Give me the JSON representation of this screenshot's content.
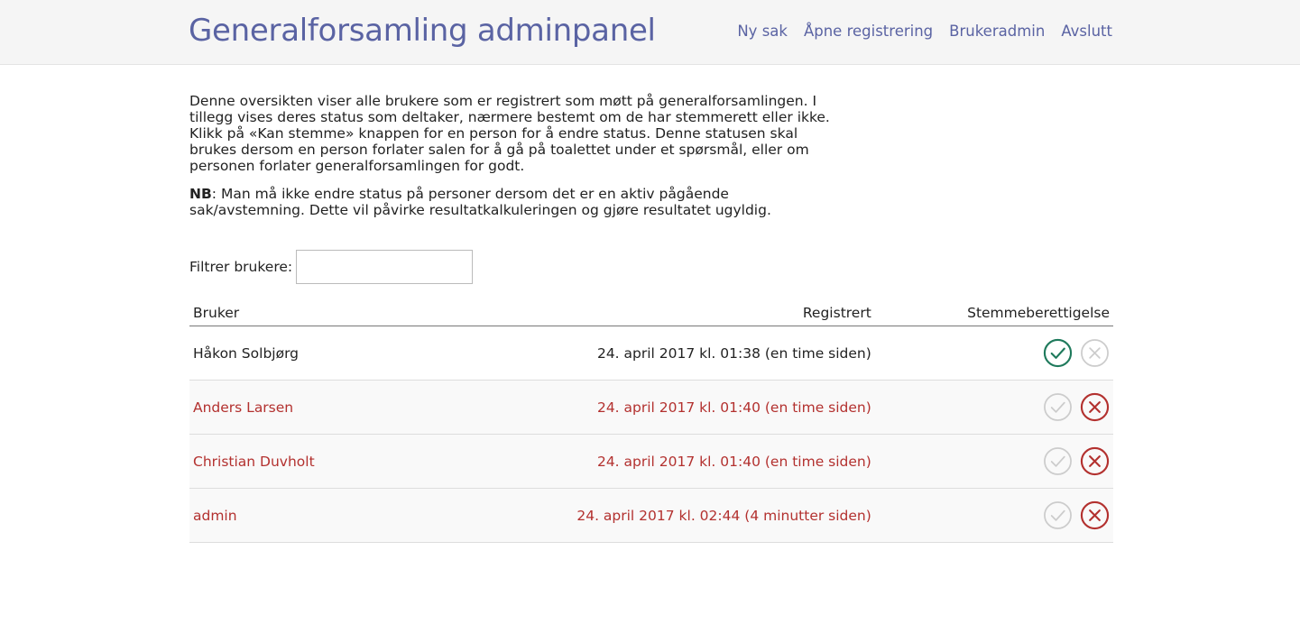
{
  "header": {
    "title": "Generalforsamling adminpanel",
    "nav": [
      "Ny sak",
      "Åpne registrering",
      "Brukeradmin",
      "Avslutt"
    ]
  },
  "intro": {
    "paragraph1": "Denne oversikten viser alle brukere som er registrert som møtt på generalforsamlingen. I tillegg vises deres status som deltaker, nærmere bestemt om de har stemmerett eller ikke. Klikk på «Kan stemme» knappen for en person for å endre status. Denne statusen skal brukes dersom en person forlater salen for å gå på toalettet under et spørsmål, eller om personen forlater generalforsamlingen for godt.",
    "nb_label": "NB",
    "paragraph2": ": Man må ikke endre status på personer dersom det er en aktiv pågående sak/avstemning. Dette vil påvirke resultatkalkuleringen og gjøre resultatet ugyldig."
  },
  "filter": {
    "label": "Filtrer brukere:",
    "value": "",
    "placeholder": ""
  },
  "table": {
    "headers": [
      "Bruker",
      "Registrert",
      "Stemmeberettigelse"
    ],
    "rows": [
      {
        "name": "Håkon Solbjørg",
        "registered": "24. april 2017 kl. 01:38 (en time siden)",
        "can_vote": true
      },
      {
        "name": "Anders Larsen",
        "registered": "24. april 2017 kl. 01:40 (en time siden)",
        "can_vote": false
      },
      {
        "name": "Christian Duvholt",
        "registered": "24. april 2017 kl. 01:40 (en time siden)",
        "can_vote": false
      },
      {
        "name": "admin",
        "registered": "24. april 2017 kl. 02:44 (4 minutter siden)",
        "can_vote": false
      }
    ]
  },
  "colors": {
    "accent": "#5a63a3",
    "active_green": "#1f7a5c",
    "inactive_red": "#b3312f",
    "muted_gray": "#cccccc"
  },
  "icons": {
    "approve": "check-circle-icon",
    "deny": "x-circle-icon"
  }
}
